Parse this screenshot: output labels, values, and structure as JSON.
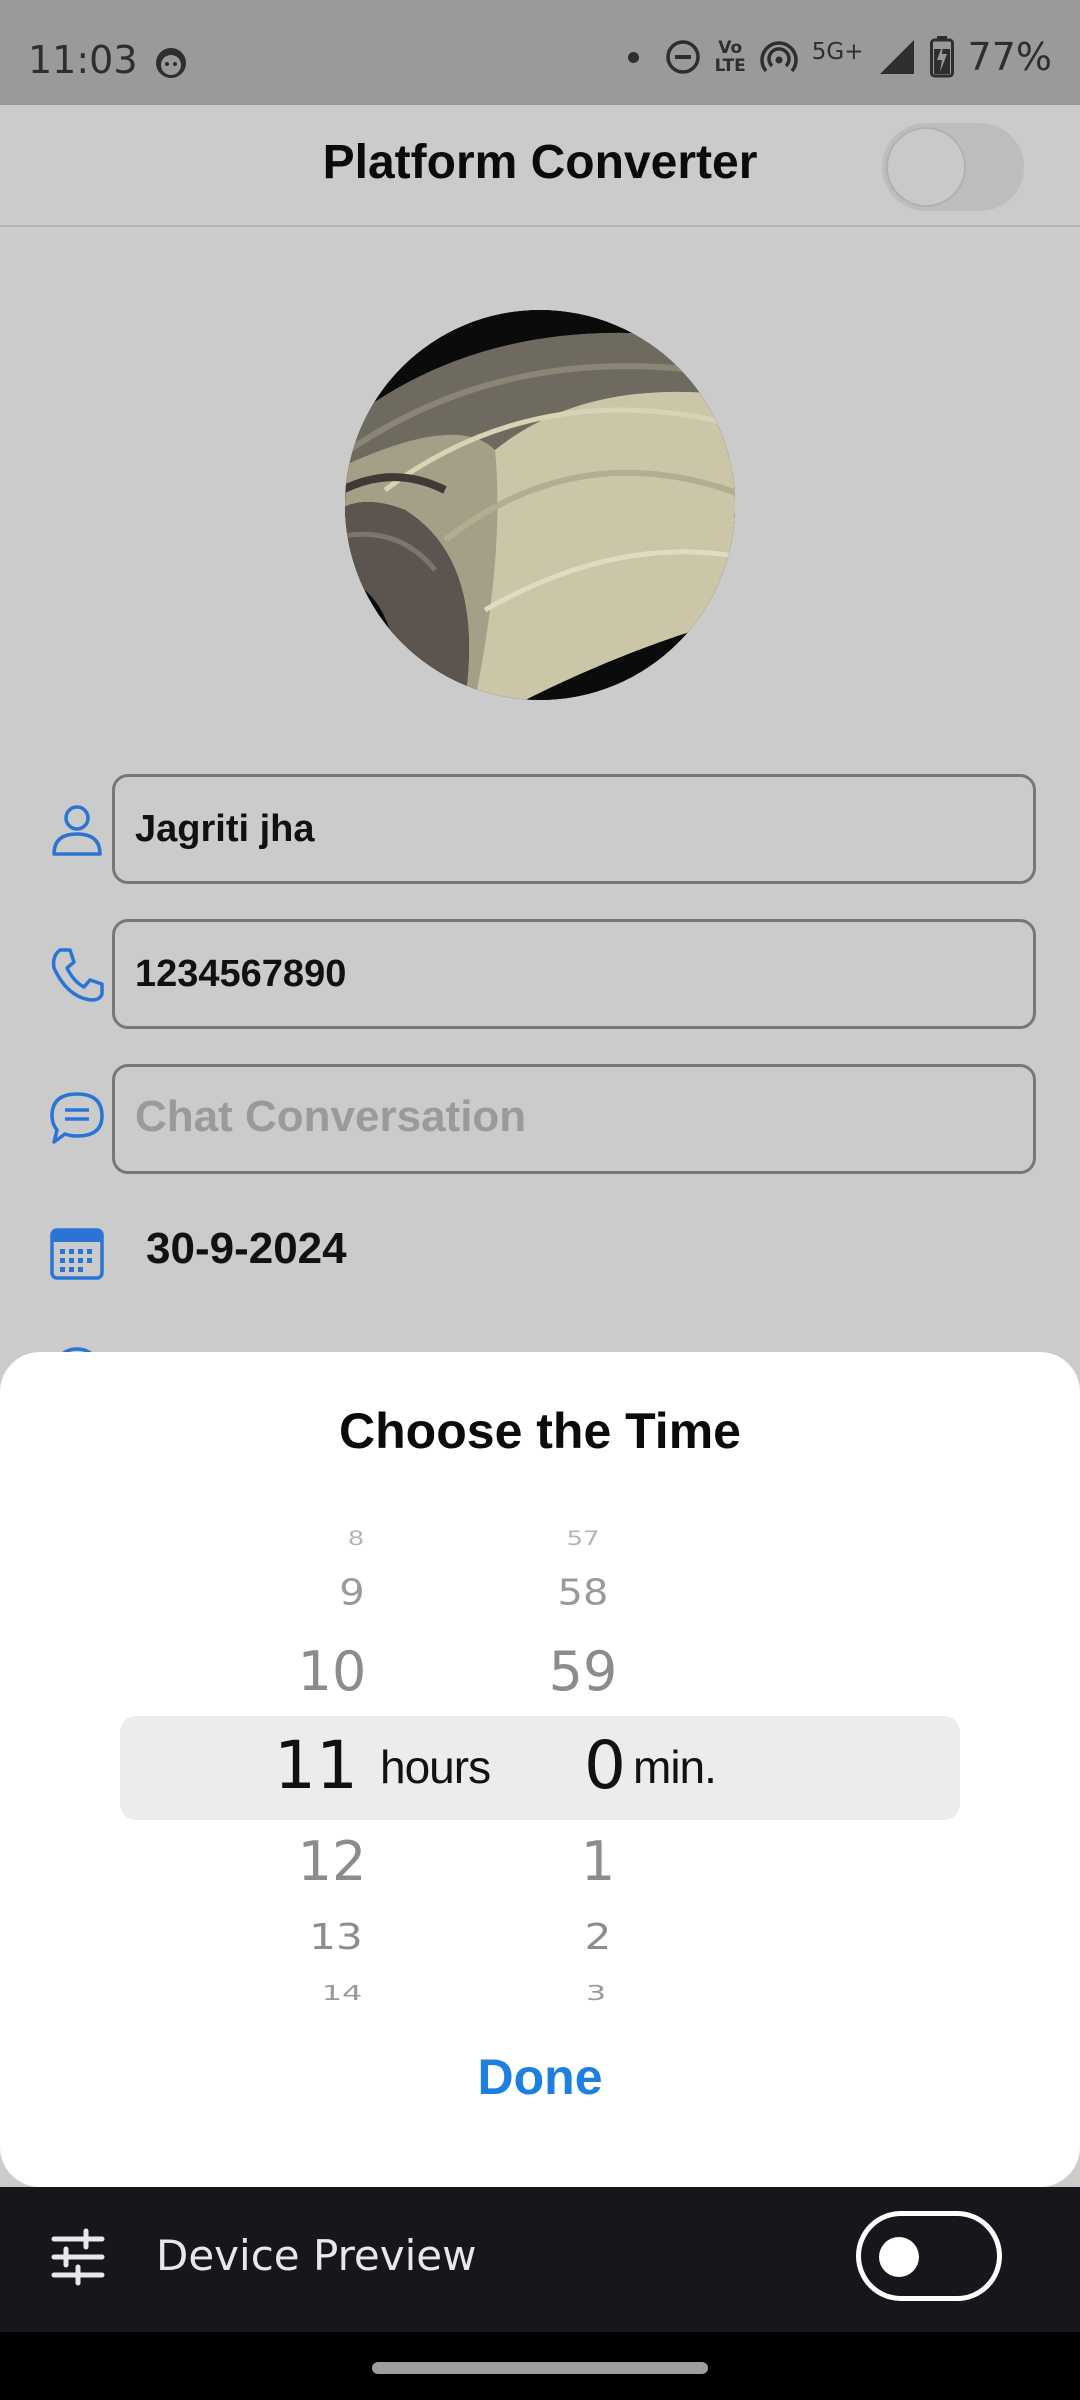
{
  "status_bar": {
    "time": "11:03",
    "volte_top": "Vo",
    "volte_bottom": "LTE",
    "network": "5G+",
    "battery": "77%"
  },
  "app_bar": {
    "title": "Platform Converter",
    "toggle_on": false
  },
  "form": {
    "name_value": "Jagriti jha",
    "phone_value": "1234567890",
    "chat_placeholder": "Chat Conversation",
    "date_value": "30-9-2024"
  },
  "time_picker": {
    "title": "Choose the Time",
    "hours": [
      "8",
      "9",
      "10",
      "11",
      "12",
      "13",
      "14"
    ],
    "minutes": [
      "57",
      "58",
      "59",
      "0",
      "1",
      "2",
      "3"
    ],
    "selected_hour": "11",
    "selected_minute": "0",
    "hours_unit": "hours",
    "minutes_unit": "min.",
    "done_label": "Done"
  },
  "device_preview": {
    "label": "Device Preview",
    "toggle_on": false
  },
  "colors": {
    "accent": "#1f7fe0",
    "icon_blue": "#2a74d6",
    "preview_bg": "#17161d"
  }
}
